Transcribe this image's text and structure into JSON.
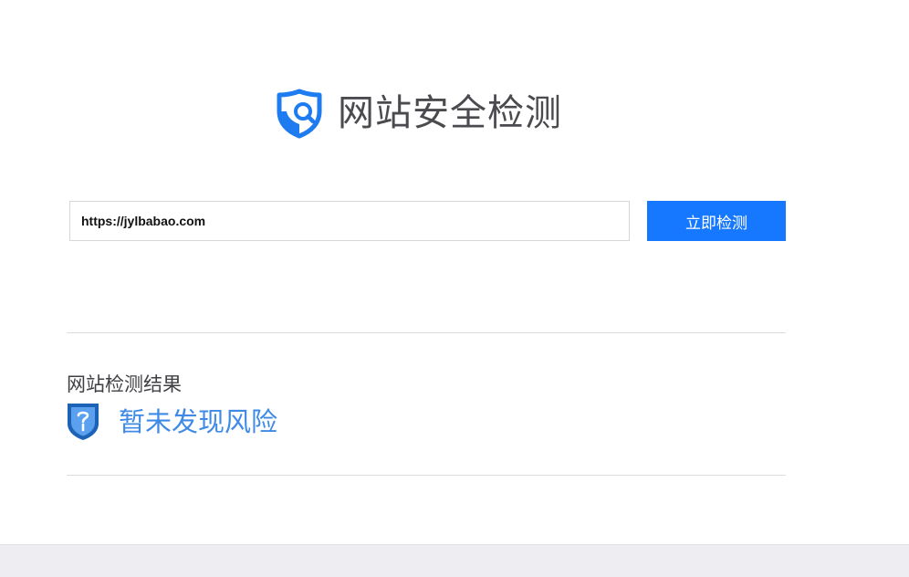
{
  "header": {
    "title": "网站安全检测",
    "logo_icon": "shield-search-icon"
  },
  "search": {
    "url_value": "https://jylbabao.com",
    "button_label": "立即检测"
  },
  "result": {
    "heading": "网站检测结果",
    "status_icon": "shield-question-icon",
    "status_text": "暂未发现风险"
  },
  "colors": {
    "primary": "#1677ff",
    "result_text": "#3e8ae6",
    "footer_bg": "#eeeef2"
  }
}
